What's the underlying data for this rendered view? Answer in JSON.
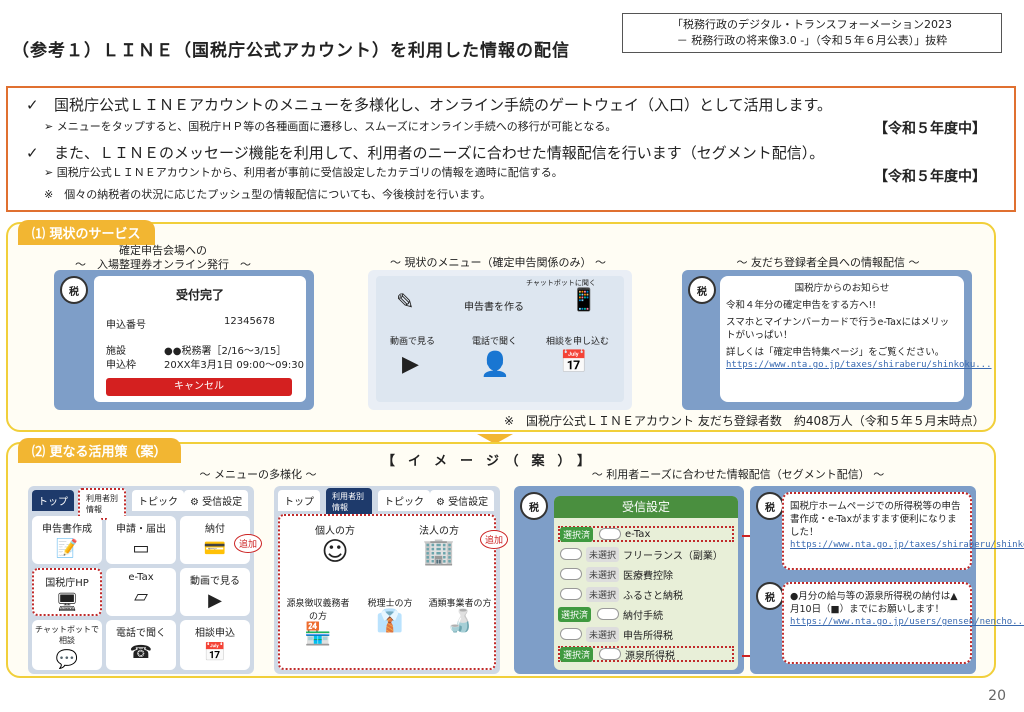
{
  "header": {
    "title": "（参考１）ＬＩＮＥ（国税庁公式アカウント）を利用した情報の配信",
    "source_line1": "「税務行政のデジタル・トランスフォーメーション2023",
    "source_line2": "－ 税務行政の将来像3.0 -」（令和５年６月公表）」抜粋"
  },
  "summary": {
    "b1": "国税庁公式ＬＩＮＥアカウントのメニューを多様化し、オンライン手続のゲートウェイ（入口）として活用します。",
    "b1_sub": "メニューをタップすると、国税庁ＨＰ等の各種画面に遷移し、スムーズにオンライン手続への移行が可能となる。",
    "b1_year": "【令和５年度中】",
    "b2": "また、ＬＩＮＥのメッセージ機能を利用して、利用者のニーズに合わせた情報配信を行います（セグメント配信）。",
    "b2_sub": "国税庁公式ＬＩＮＥアカウントから、利用者が事前に受信設定したカテゴリの情報を適時に配信する。",
    "b2_year": "【令和５年度中】",
    "note": "※　個々の納税者の状況に応じたプッシュ型の情報配信についても、今後検討を行います。",
    "check_mark": "✓",
    "sub_mark": "➢"
  },
  "section1": {
    "tab": "⑴ 現状のサービス",
    "p1_caption1": "確定申告会場への",
    "p1_caption2": "～　入場整理券オンライン発行　～",
    "p1_status": "受付完了",
    "p1_number_label": "申込番号",
    "p1_number": "12345678",
    "p1_office_label": "施設",
    "p1_office": "●●税務署［2/16～3/15］",
    "p1_slot_label": "申込枠",
    "p1_slot": "20XX年3月1日 09:00～09:30",
    "p1_cancel": "キャンセル",
    "p2_caption": "～ 現状のメニュー（確定申告関係のみ） ～",
    "p2_chatbot": "チャットボットに聞く",
    "p2_create": "申告書を作る",
    "p2_video": "動画で見る",
    "p2_phone": "電話で聞く",
    "p2_consult": "相談を申し込む",
    "p3_caption": "～ 友だち登録者全員への情報配信 ～",
    "p3_header": "国税庁からのお知らせ",
    "p3_line1": "令和４年分の確定申告をする方へ!!",
    "p3_line2": "スマホとマイナンバーカードで行うe-Taxにはメリットがいっぱい！",
    "p3_line3": "詳しくは「確定申告特集ページ」をご覧ください。",
    "p3_url": "https://www.nta.go.jp/taxes/shiraberu/shinkoku...",
    "footnote": "※　国税庁公式ＬＩＮＥアカウント 友だち登録者数　約408万人（令和５年５月末時点）"
  },
  "section2": {
    "tab": "⑵ 更なる活用策（案）",
    "image_label": "【　イ　メ　ー　ジ　（　案　）　】",
    "menu_caption": "～ メニューの多様化 ～",
    "seg_caption": "～ 利用者ニーズに合わせた情報配信（セグメント配信） ～",
    "tabs": [
      "トップ",
      "利用者別情報",
      "トピック",
      "受信設定"
    ],
    "left_tiles": [
      "申告書作成",
      "申請・届出",
      "納付",
      "国税庁HP",
      "e-Tax",
      "動画で見る",
      "チャットボットで相談",
      "電話で聞く",
      "相談申込"
    ],
    "add_label": "追加",
    "mid_tiles": [
      "個人の方",
      "法人の方",
      "源泉徴収義務者の方",
      "税理士の方",
      "酒類事業者の方"
    ],
    "settings_header": "受信設定",
    "settings": [
      {
        "state": "選択済",
        "label": "e-Tax"
      },
      {
        "state": "未選択",
        "label": "フリーランス（副業）"
      },
      {
        "state": "未選択",
        "label": "医療費控除"
      },
      {
        "state": "未選択",
        "label": "ふるさと納税"
      },
      {
        "state": "選択済",
        "label": "納付手続"
      },
      {
        "state": "未選択",
        "label": "申告所得税"
      },
      {
        "state": "選択済",
        "label": "源泉所得税"
      }
    ],
    "msg1": "国税庁ホームページでの所得税等の申告書作成・e-Taxがますます便利になりました！",
    "msg1_url": "https://www.nta.go.jp/taxes/shiraberu/shinkoku...",
    "msg2": "●月分の給与等の源泉所得税の納付は▲月10日（■）までにお願いします！",
    "msg2_url": "https://www.nta.go.jp/users/gensen/nencho...",
    "avatar_label": "税"
  },
  "page_number": "20"
}
